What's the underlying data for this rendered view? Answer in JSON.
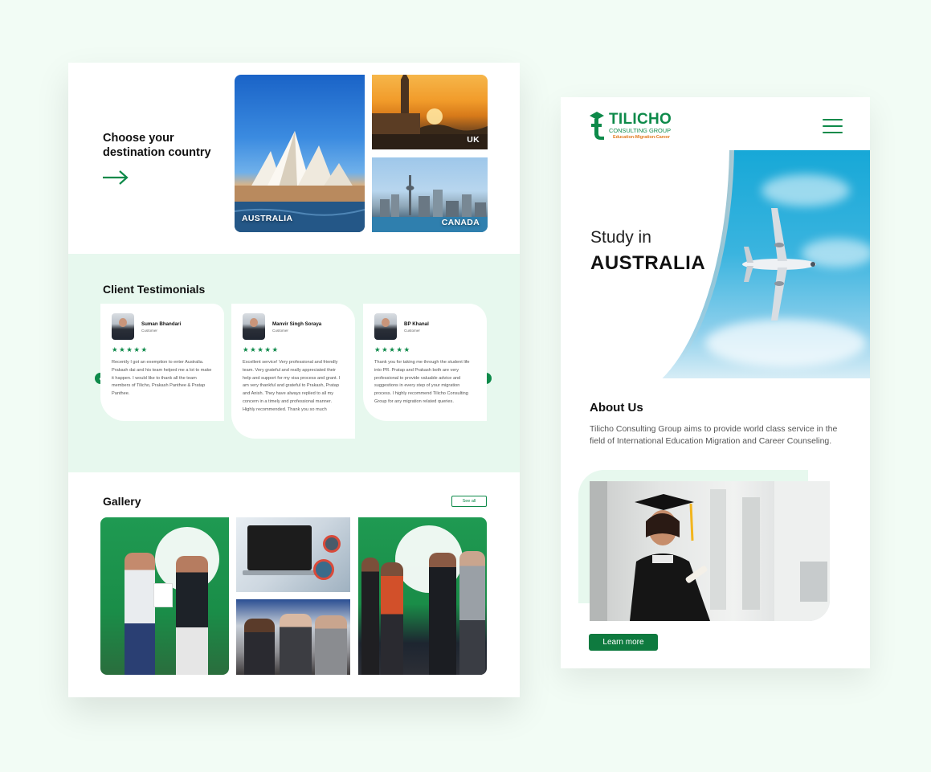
{
  "destinations": {
    "heading": "Choose your destination country",
    "cards": [
      {
        "label": "AUSTRALIA"
      },
      {
        "label": "UK"
      },
      {
        "label": "CANADA"
      }
    ]
  },
  "testimonials": {
    "heading": "Client Testimonials",
    "stars": "★★★★★",
    "items": [
      {
        "name": "Suman Bhandari",
        "role": "Customer",
        "text": "Recently I got an exemption to enter Australia. Prakash dai and his team helped me a lot to make it happen. I would like to thank all the team members of Tilicho, Prakash Panthee & Pratap Panthee."
      },
      {
        "name": "Manvir Singh Soraya",
        "role": "Customer",
        "text": "Excellent service! Very professional and friendly team. Very grateful and really appreciated their help and support for my visa process and grant. I am very thankful and grateful to Prakash, Pratap and Anish. They have always replied to all my concern in a timely and professional manner. Highly recommended. Thank you so much"
      },
      {
        "name": "BP Khanal",
        "role": "Customer",
        "text": "Thank you for taking me through the student life into PR. Pratap and Prakash both are very professional to provide valuable advice and suggestions in every step of your migration process. I highly recommend Tilicho Consulting Group for any migration related queries."
      }
    ]
  },
  "gallery": {
    "heading": "Gallery",
    "see_all": "See all"
  },
  "mobile": {
    "logo": {
      "name": "TILICHO",
      "sub": "CONSULTING GROUP",
      "tagline": "Education-Migration-Career"
    },
    "hero": {
      "subtitle": "Study in",
      "title": "AUSTRALIA"
    },
    "about": {
      "heading": "About Us",
      "text": "Tilicho Consulting Group aims to provide world class service in the field of International Education Migration and Career Counseling.",
      "button": "Learn more"
    }
  },
  "colors": {
    "brand_green": "#0e8a4a",
    "mint_bg": "#e7f8ee",
    "accent_orange": "#e2791d",
    "page_bg": "#f2fcf5"
  }
}
